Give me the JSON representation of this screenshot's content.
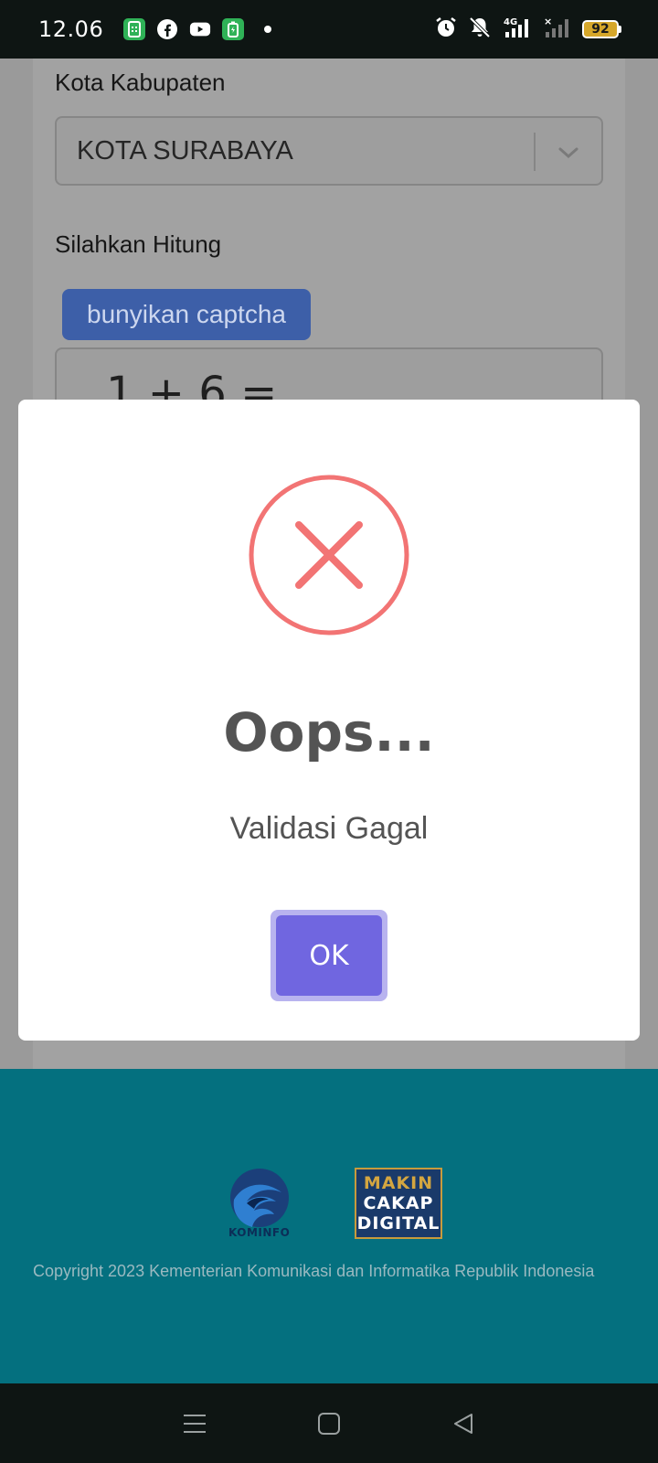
{
  "status_bar": {
    "time": "12.06",
    "battery_level": "92",
    "network_label": "4G",
    "icons": [
      "phone-app-icon",
      "facebook-icon",
      "youtube-icon",
      "battery-saver-app-icon",
      "notification-dot",
      "alarm-icon",
      "mute-icon",
      "signal-4g-icon",
      "signal-no-service-icon",
      "battery-icon"
    ]
  },
  "form": {
    "region_label": "Kota Kabupaten",
    "region_value": "KOTA SURABAYA",
    "captcha_label": "Silahkan Hitung",
    "captcha_audio_button": "bunyikan captcha",
    "captcha_question": "1 + 6 ="
  },
  "dialog": {
    "icon": "error-x-icon",
    "title": "Oops...",
    "message": "Validasi Gagal",
    "ok_label": "OK"
  },
  "footer": {
    "kominfo_logo_text": "KOMINFO",
    "mcd_logo_lines": [
      "MAKIN",
      "CAKAP",
      "DIGITAL"
    ],
    "copyright": "Copyright 2023 Kementerian Komunikasi dan Informatika Republik Indonesia"
  },
  "nav_bar": {
    "buttons": [
      "recents-menu-icon",
      "home-square-icon",
      "back-triangle-icon"
    ]
  },
  "colors": {
    "overlay_gray": "#9a9a9a",
    "footer_teal": "#04707f",
    "error_red": "#f27474",
    "ok_button": "#7066e0",
    "ok_button_ring": "#b8b3ef",
    "status_bar": "#0e1513"
  }
}
